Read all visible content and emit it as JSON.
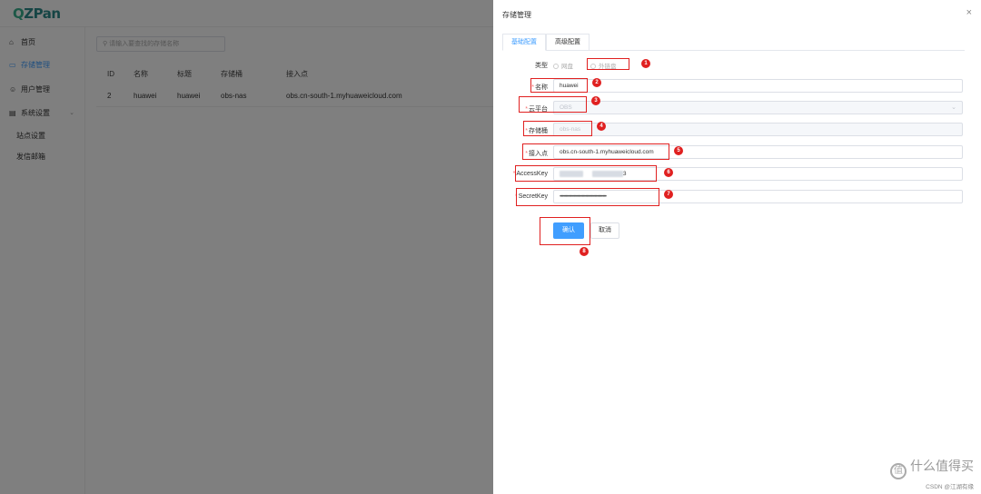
{
  "app": {
    "logo": "ZPan",
    "search_placeholder": "请输入要查找的存储名称"
  },
  "sidebar": {
    "items": [
      {
        "label": "首页",
        "icon": "home-icon"
      },
      {
        "label": "存储管理",
        "icon": "storage-icon"
      },
      {
        "label": "用户管理",
        "icon": "user-icon"
      },
      {
        "label": "系统设置",
        "icon": "settings-icon"
      },
      {
        "label": "站点设置"
      },
      {
        "label": "发信邮箱"
      }
    ]
  },
  "table": {
    "headers": [
      "ID",
      "名称",
      "标题",
      "存储桶",
      "接入点"
    ],
    "rows": [
      [
        "2",
        "huawei",
        "huawei",
        "obs-nas",
        "obs.cn-south-1.myhuaweicloud.com"
      ]
    ]
  },
  "drawer": {
    "title": "存储管理",
    "tabs": [
      "基础配置",
      "高级配置"
    ],
    "type_label": "类型",
    "type_options": [
      "网盘",
      "外链盘"
    ],
    "name_label": "名称",
    "name_value": "huawei",
    "cloud_label": "云平台",
    "cloud_value": "OBS",
    "bucket_label": "存储桶",
    "bucket_value": "obs-nas",
    "endpoint_label": "接入点",
    "endpoint_value": "obs.cn-south-1.myhuaweicloud.com",
    "access_label": "AccessKey",
    "access_suffix": "3",
    "secret_label": "SecretKey",
    "secret_value": "••••••••••••••••••••••••••••••••••••••••",
    "confirm_label": "确认",
    "cancel_label": "取消",
    "badges": [
      "1",
      "2",
      "3",
      "4",
      "5",
      "6",
      "7",
      "8"
    ]
  },
  "watermark": {
    "text": "什么值得买",
    "sub": "CSDN @江湖有缘"
  },
  "colors": {
    "accent": "#409eff",
    "annotation": "#e02020"
  }
}
